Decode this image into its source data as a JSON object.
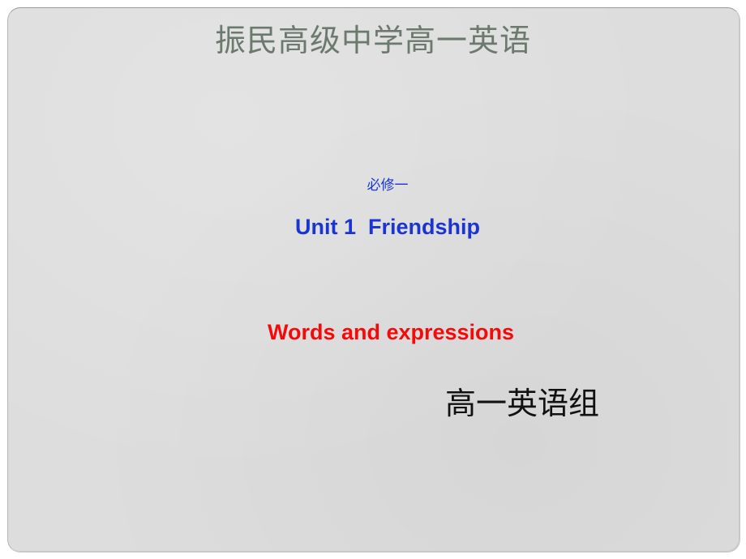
{
  "slide": {
    "title": "振民高级中学高一英语",
    "module": "必修一",
    "unit_title": "Unit 1  Friendship",
    "subtitle": "Words and expressions",
    "author_group": "高一英语组"
  },
  "colors": {
    "title": "#6c7a6e",
    "module": "#1a35d0",
    "unit_title": "#1a35d0",
    "subtitle": "#f50a0a",
    "author_group": "#111111",
    "slide_background": "#dddddd"
  }
}
